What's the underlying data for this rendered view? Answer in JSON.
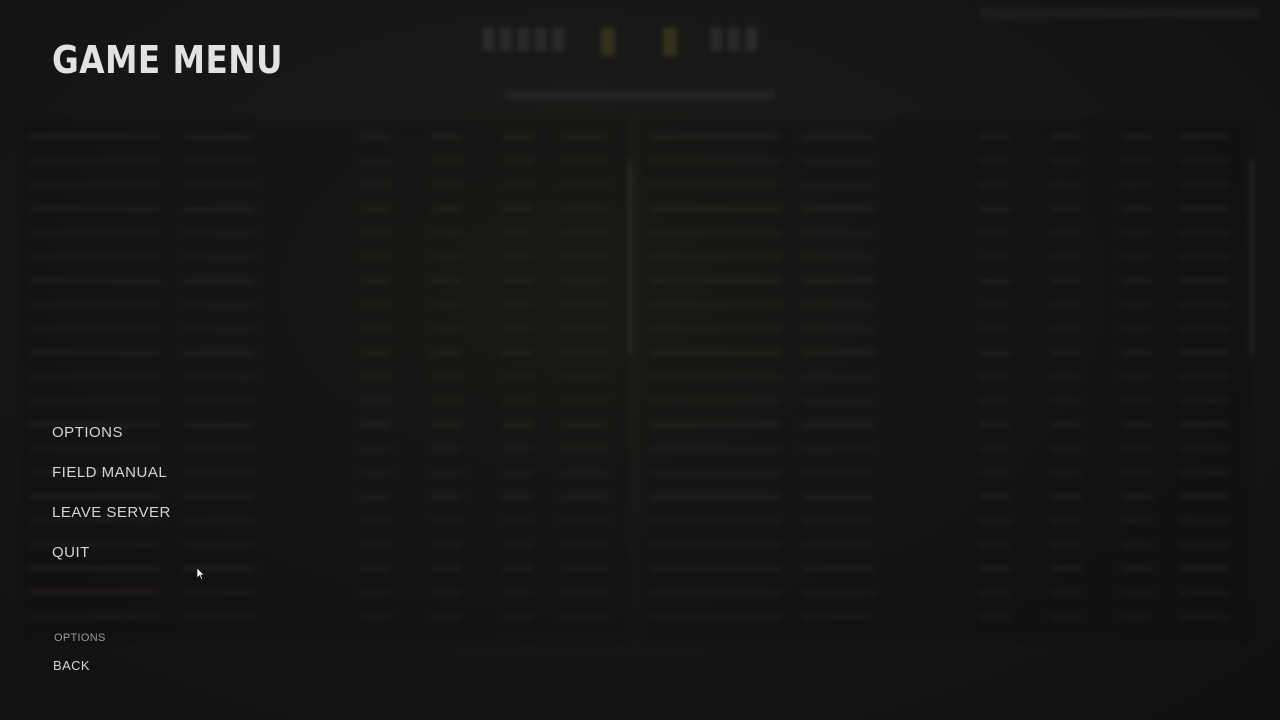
{
  "menu": {
    "title": "GAME MENU",
    "items": [
      {
        "label": "OPTIONS"
      },
      {
        "label": "FIELD MANUAL"
      },
      {
        "label": "LEAVE SERVER"
      },
      {
        "label": "QUIT"
      }
    ]
  },
  "footer": {
    "caption": "OPTIONS",
    "back_label": "BACK"
  },
  "cursor_icon": "arrow-pointer-icon",
  "colors": {
    "background": "#141414",
    "text_primary": "#e2e2e2",
    "text_secondary": "#9a9a9a"
  }
}
